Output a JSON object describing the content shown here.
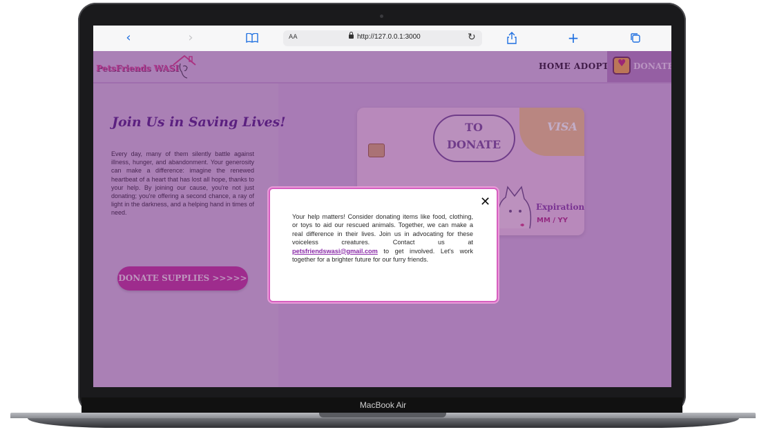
{
  "device": {
    "label": "MacBook Air"
  },
  "browser": {
    "aa_label": "AA",
    "url": "http://127.0.0.1:3000"
  },
  "nav": {
    "logo": "PetsFriends WASI",
    "links": [
      "HOME",
      "ADOPT"
    ],
    "donate": "DONATE"
  },
  "hero": {
    "heading": "Join Us in Saving Lives!",
    "paragraph": "Every day, many of them silently battle against illness, hunger, and abandonment. Your generosity can make a difference: imagine the renewed heartbeat of a heart that has lost all hope, thanks to your help. By joining our cause, you're not just donating; you're offering a second chance, a ray of light in the darkness, and a helping hand in times of need.",
    "button": "DONATE SUPPLIES >>>>>"
  },
  "card": {
    "cloud_line1": "TO",
    "cloud_line2": "DONATE",
    "brand": "VISA",
    "expiration_label": "Expiration",
    "expiration_value": "MM / YY"
  },
  "modal": {
    "close": "✕",
    "text_before": "Your help matters! Consider donating items like food, clothing, or toys to aid our rescued animals. Together, we can make a real difference in their lives. Join us in advocating for these voiceless creatures. Contact us at ",
    "email": "petsfriendswasi@gmail.com",
    "text_after": " to get involved. Let's work together for a brighter future for our furry friends."
  }
}
